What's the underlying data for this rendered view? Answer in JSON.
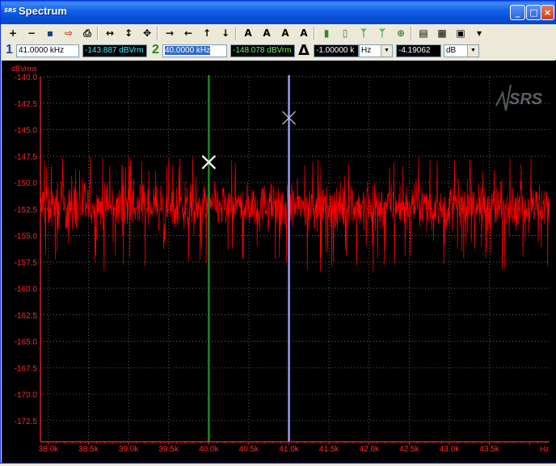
{
  "window": {
    "title": "Spectrum",
    "title_icon": "SRS",
    "minimize_label": "_",
    "maximize_label": "□",
    "close_label": "×"
  },
  "toolbar": {
    "tools": [
      {
        "name": "zoom-in-tool",
        "glyph": "+"
      },
      {
        "name": "zoom-out-tool",
        "glyph": "−"
      },
      {
        "name": "save-icon",
        "glyph": "▪"
      },
      {
        "name": "export-icon",
        "glyph": "⇨"
      },
      {
        "name": "print-icon",
        "glyph": "⎙"
      },
      {
        "name": "fit-horizontal-icon",
        "glyph": "↔"
      },
      {
        "name": "fit-vertical-icon",
        "glyph": "↕"
      },
      {
        "name": "fit-all-icon",
        "glyph": "✥"
      },
      {
        "name": "pan-right-icon",
        "glyph": "→"
      },
      {
        "name": "pan-left-icon",
        "glyph": "←"
      },
      {
        "name": "pan-up-icon",
        "glyph": "↑"
      },
      {
        "name": "pan-down-icon",
        "glyph": "↓"
      },
      {
        "name": "cursor-a-icon",
        "glyph": "A"
      },
      {
        "name": "cursor-b-icon",
        "glyph": "A"
      },
      {
        "name": "peak-a-icon",
        "glyph": "A"
      },
      {
        "name": "peak-b-icon",
        "glyph": "A"
      },
      {
        "name": "bar-chart-icon",
        "glyph": "▮"
      },
      {
        "name": "bar-chart-log-icon",
        "glyph": "▯"
      },
      {
        "name": "marker-left-icon",
        "glyph": "ᛉ"
      },
      {
        "name": "marker-right-icon",
        "glyph": "ᛉ"
      },
      {
        "name": "target-icon",
        "glyph": "⊕"
      },
      {
        "name": "copy-icon",
        "glyph": "▤"
      },
      {
        "name": "table-icon",
        "glyph": "▦"
      },
      {
        "name": "calculator-icon",
        "glyph": "▣"
      },
      {
        "name": "more-dropdown-icon",
        "glyph": "▾"
      }
    ]
  },
  "cursors": {
    "cursor1": {
      "number": "1",
      "frequency": "41.0000 kHz",
      "level": "-143.887 dBVrm"
    },
    "cursor2": {
      "number": "2",
      "frequency": "40.0000 kHz",
      "level": "-148.078 dBVrm"
    },
    "delta": {
      "symbol": "Δ",
      "frequency": "-1.00000 k",
      "frequency_unit": "Hz",
      "level": "-4.19062",
      "level_unit": "dB"
    },
    "colors": {
      "cursor1": "#9a9cf2",
      "cursor2": "#1c8a1c"
    }
  },
  "chart_data": {
    "type": "line",
    "ylabel": "dBVrms",
    "xlabel": "Hz",
    "xlim": [
      37900,
      44250
    ],
    "ylim": [
      -174.5,
      -140.0
    ],
    "x_ticks": [
      "38.0k",
      "38.5k",
      "39.0k",
      "39.5k",
      "40.0k",
      "40.5k",
      "41.0k",
      "41.5k",
      "42.0k",
      "42.5k",
      "43.0k",
      "43.5k"
    ],
    "x_tick_values": [
      38000,
      38500,
      39000,
      39500,
      40000,
      40500,
      41000,
      41500,
      42000,
      42500,
      43000,
      43500
    ],
    "y_ticks": [
      "-140.0",
      "-142.5",
      "-145.0",
      "-147.5",
      "-150.0",
      "-152.5",
      "-155.0",
      "-157.5",
      "-160.0",
      "-162.5",
      "-165.0",
      "-167.5",
      "-170.0",
      "-172.5"
    ],
    "y_tick_values": [
      -140.0,
      -142.5,
      -145.0,
      -147.5,
      -150.0,
      -152.5,
      -155.0,
      -157.5,
      -160.0,
      -162.5,
      -165.0,
      -167.5,
      -170.0,
      -172.5
    ],
    "noise_floor": {
      "mean": -152.5,
      "typical_min": -155.5,
      "typical_max": -149.0,
      "extreme_min": -158.5,
      "extreme_max": -147.5
    },
    "cursor_markers": [
      {
        "x": 40000,
        "y": -148.078,
        "color": "#1c8a1c"
      },
      {
        "x": 41000,
        "y": -143.887,
        "color": "#9a9cf2"
      }
    ],
    "grid": true,
    "trace_color": "#ff0000",
    "axis_color": "#ff2a2a",
    "watermark": "SRS"
  }
}
